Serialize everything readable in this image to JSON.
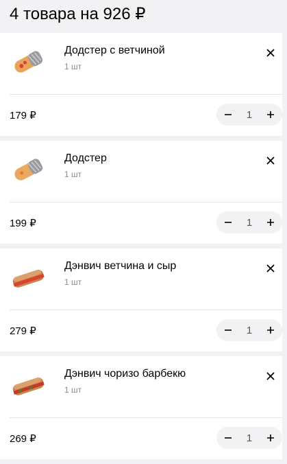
{
  "header": {
    "title": "4 товара на 926 ₽"
  },
  "items": [
    {
      "name": "Додстер с ветчиной",
      "qty_label": "1 шт",
      "price": "179 ₽",
      "qty": "1",
      "image": "wrap"
    },
    {
      "name": "Додстер",
      "qty_label": "1 шт",
      "price": "199 ₽",
      "qty": "1",
      "image": "wrap"
    },
    {
      "name": "Дэнвич ветчина и сыр",
      "qty_label": "1 шт",
      "price": "279 ₽",
      "qty": "1",
      "image": "sandwich"
    },
    {
      "name": "Дэнвич чоризо барбекю",
      "qty_label": "1 шт",
      "price": "269 ₽",
      "qty": "1",
      "image": "sandwich"
    }
  ],
  "icons": {
    "remove": "close-icon",
    "decrease": "minus-icon",
    "increase": "plus-icon"
  }
}
